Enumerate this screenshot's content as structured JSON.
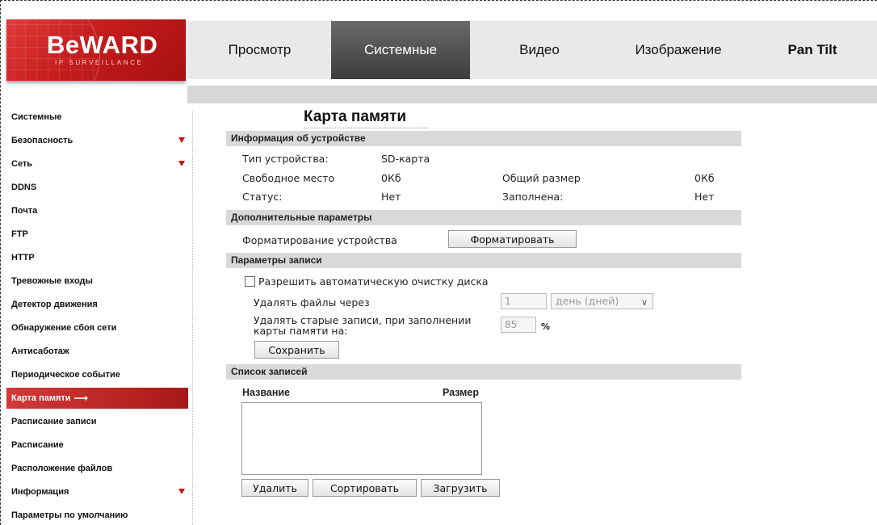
{
  "brand": {
    "name": "BeWARD",
    "tagline": "IP SURVEILLANCE"
  },
  "topnav": {
    "tabs": [
      {
        "label": "Просмотр",
        "active": false
      },
      {
        "label": "Системные",
        "active": true
      },
      {
        "label": "Видео",
        "active": false
      },
      {
        "label": "Изображение",
        "active": false
      },
      {
        "label": "Pan Tilt",
        "active": false
      }
    ]
  },
  "sidebar": {
    "items": [
      {
        "label": "Системные",
        "expandable": false
      },
      {
        "label": "Безопасность",
        "expandable": true
      },
      {
        "label": "Сеть",
        "expandable": true
      },
      {
        "label": "DDNS",
        "expandable": false
      },
      {
        "label": "Почта",
        "expandable": false
      },
      {
        "label": "FTP",
        "expandable": false
      },
      {
        "label": "HTTP",
        "expandable": false
      },
      {
        "label": "Тревожные входы",
        "expandable": false
      },
      {
        "label": "Детектор движения",
        "expandable": false
      },
      {
        "label": "Обнаружение сбоя сети",
        "expandable": false
      },
      {
        "label": "Антисаботаж",
        "expandable": false
      },
      {
        "label": "Периодическое событие",
        "expandable": false
      },
      {
        "label": "Карта памяти",
        "expandable": false,
        "active": true,
        "arrow": "⟶"
      },
      {
        "label": "Расписание записи",
        "expandable": false
      },
      {
        "label": "Расписание",
        "expandable": false
      },
      {
        "label": "Расположение файлов",
        "expandable": false
      },
      {
        "label": "Информация",
        "expandable": true
      },
      {
        "label": "Параметры по умолчанию",
        "expandable": false
      }
    ]
  },
  "page": {
    "title": "Карта памяти"
  },
  "device_info": {
    "header": "Информация об устройстве",
    "type_label": "Тип устройства:",
    "type_value": "SD-карта",
    "free_label": "Свободное место",
    "free_value": "0Кб",
    "total_label": "Общий размер",
    "total_value": "0Кб",
    "status_label": "Статус:",
    "status_value": "Нет",
    "full_label": "Заполнена:",
    "full_value": "Нет"
  },
  "extra": {
    "header": "Дополнительные параметры",
    "format_label": "Форматирование устройства",
    "format_button": "Форматировать"
  },
  "record": {
    "header": "Параметры записи",
    "auto_clean_label": "Разрешить автоматическую очистку диска",
    "auto_clean_checked": false,
    "delete_after_label": "Удалять файлы через",
    "delete_after_value": "1",
    "delete_after_unit": "день (дней)",
    "delete_old_label_1": "Удалять старые записи, при заполнении",
    "delete_old_label_2": "карты памяти на:",
    "delete_old_value": "85",
    "delete_old_unit": "%",
    "save_button": "Сохранить"
  },
  "records_list": {
    "header": "Список записей",
    "col_name": "Название",
    "col_size": "Размер",
    "rows": [],
    "delete_button": "Удалить",
    "sort_button": "Сортировать",
    "download_button": "Загрузить"
  },
  "colors": {
    "accent": "#c41c1c",
    "active_tab": "#4a4a4a",
    "section_bg": "#d9d9d9"
  }
}
